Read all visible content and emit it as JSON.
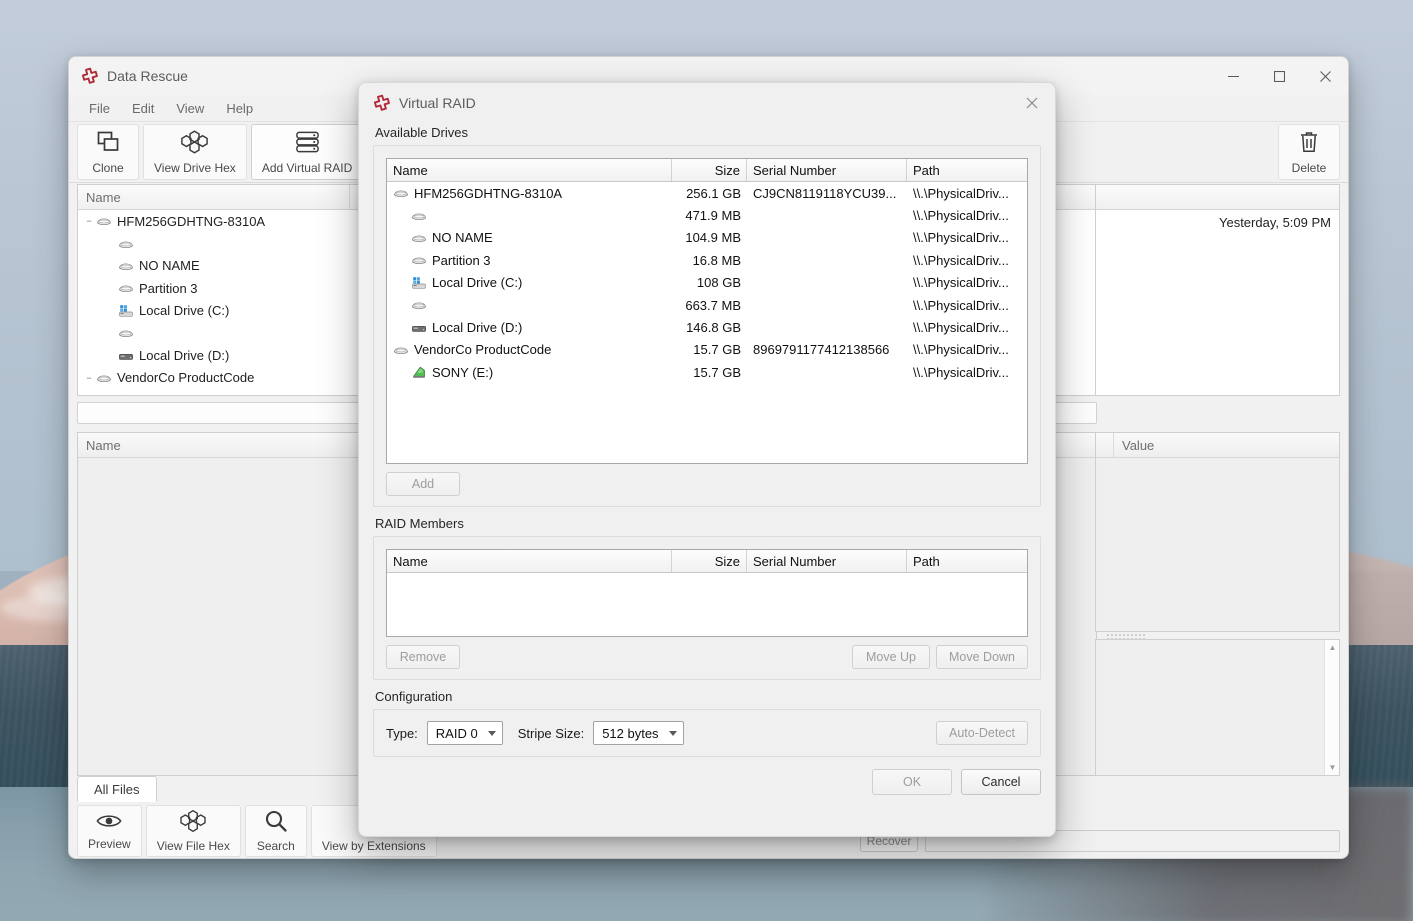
{
  "app": {
    "title": "Data Rescue",
    "menu": [
      "File",
      "Edit",
      "View",
      "Help"
    ],
    "window_controls": {
      "minimize": "minimize-icon",
      "maximize": "maximize-icon",
      "close": "close-icon"
    },
    "toolbar": [
      {
        "label": "Clone",
        "icon": "clone-icon"
      },
      {
        "label": "View Drive Hex",
        "icon": "hex-grid-icon"
      },
      {
        "label": "Add Virtual RAID",
        "icon": "raid-stack-icon"
      }
    ],
    "delete_button": {
      "label": "Delete",
      "icon": "trash-icon"
    },
    "tree_header": "Name",
    "tree_rows": [
      {
        "label": "HFM256GDHTNG-8310A",
        "size": "2",
        "indent": 0,
        "icon": "disk-icon",
        "twisty": "minus"
      },
      {
        "label": "",
        "size": "4",
        "indent": 1,
        "icon": "disk-icon",
        "twisty": ""
      },
      {
        "label": "NO NAME",
        "size": "10",
        "indent": 1,
        "icon": "disk-icon",
        "twisty": ""
      },
      {
        "label": "Partition 3",
        "size": "",
        "indent": 1,
        "icon": "disk-icon",
        "twisty": ""
      },
      {
        "label": "Local Drive (C:)",
        "size": "",
        "indent": 1,
        "icon": "windows-drive-icon",
        "twisty": ""
      },
      {
        "label": "",
        "size": "6",
        "indent": 1,
        "icon": "disk-icon",
        "twisty": ""
      },
      {
        "label": "Local Drive (D:)",
        "size": "1",
        "indent": 1,
        "icon": "hdd-icon",
        "twisty": ""
      },
      {
        "label": "VendorCo ProductCode",
        "size": "",
        "indent": 0,
        "icon": "disk-icon",
        "twisty": "minus"
      },
      {
        "label": "SONY (E:)",
        "size": "",
        "indent": 1,
        "icon": "usb-drive-icon",
        "twisty": ""
      }
    ],
    "file_list_header": "Name",
    "metadata_timestamp": "Yesterday, 5:09 PM",
    "properties_value_header": "Value",
    "tab_all_files": "All Files",
    "bottom_toolbar": [
      {
        "label": "Preview",
        "icon": "eye-icon"
      },
      {
        "label": "View File Hex",
        "icon": "hex-grid-icon"
      },
      {
        "label": "Search",
        "icon": "search-icon"
      },
      {
        "label": "View by Extensions",
        "icon": "extensions-icon"
      }
    ],
    "recover_button": "Recover"
  },
  "dialog": {
    "title": "Virtual RAID",
    "close_icon": "close-icon",
    "available_drives": {
      "label": "Available Drives",
      "columns": [
        "Name",
        "Size",
        "Serial Number",
        "Path"
      ],
      "rows": [
        {
          "name": "HFM256GDHTNG-8310A",
          "size": "256.1 GB",
          "serial": "CJ9CN8119118YCU39...",
          "path": "\\\\.\\PhysicalDriv...",
          "indent": 0,
          "icon": "disk-icon"
        },
        {
          "name": "",
          "size": "471.9 MB",
          "serial": "",
          "path": "\\\\.\\PhysicalDriv...",
          "indent": 1,
          "icon": "disk-icon"
        },
        {
          "name": "NO NAME",
          "size": "104.9 MB",
          "serial": "",
          "path": "\\\\.\\PhysicalDriv...",
          "indent": 1,
          "icon": "disk-icon"
        },
        {
          "name": "Partition 3",
          "size": "16.8 MB",
          "serial": "",
          "path": "\\\\.\\PhysicalDriv...",
          "indent": 1,
          "icon": "disk-icon"
        },
        {
          "name": "Local Drive (C:)",
          "size": "108 GB",
          "serial": "",
          "path": "\\\\.\\PhysicalDriv...",
          "indent": 1,
          "icon": "windows-drive-icon"
        },
        {
          "name": "",
          "size": "663.7 MB",
          "serial": "",
          "path": "\\\\.\\PhysicalDriv...",
          "indent": 1,
          "icon": "disk-icon"
        },
        {
          "name": "Local Drive (D:)",
          "size": "146.8 GB",
          "serial": "",
          "path": "\\\\.\\PhysicalDriv...",
          "indent": 1,
          "icon": "hdd-icon"
        },
        {
          "name": "VendorCo ProductCode",
          "size": "15.7 GB",
          "serial": "8969791177412138566",
          "path": "\\\\.\\PhysicalDriv...",
          "indent": 0,
          "icon": "disk-icon"
        },
        {
          "name": "SONY (E:)",
          "size": "15.7 GB",
          "serial": "",
          "path": "\\\\.\\PhysicalDriv...",
          "indent": 1,
          "icon": "usb-drive-icon"
        }
      ],
      "add_button": "Add"
    },
    "raid_members": {
      "label": "RAID Members",
      "columns": [
        "Name",
        "Size",
        "Serial Number",
        "Path"
      ],
      "rows": [],
      "remove_button": "Remove",
      "move_up_button": "Move Up",
      "move_down_button": "Move Down"
    },
    "configuration": {
      "label": "Configuration",
      "type_label": "Type:",
      "type_value": "RAID 0",
      "stripe_label": "Stripe Size:",
      "stripe_value": "512 bytes",
      "auto_detect_button": "Auto-Detect"
    },
    "footer": {
      "ok_button": "OK",
      "cancel_button": "Cancel"
    }
  },
  "colors": {
    "brand_red": "#b02a37",
    "dialog_bg": "#f0f0f0",
    "window_bg": "#f1f1f1",
    "accent_blue": "#2a7ad2",
    "usb_green": "#4caf50"
  }
}
